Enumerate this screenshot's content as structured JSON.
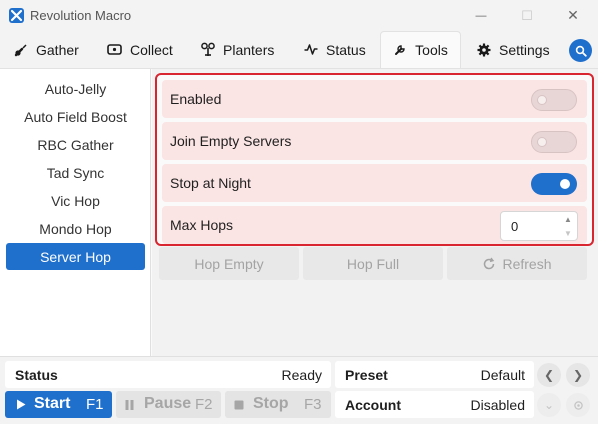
{
  "window": {
    "title": "Revolution Macro",
    "minimize_glyph": "—",
    "maximize_glyph": "☐",
    "close_glyph": "✕"
  },
  "tabs": [
    {
      "label": "Gather",
      "icon": "gather-icon"
    },
    {
      "label": "Collect",
      "icon": "collect-icon"
    },
    {
      "label": "Planters",
      "icon": "planters-icon"
    },
    {
      "label": "Status",
      "icon": "status-icon"
    },
    {
      "label": "Tools",
      "icon": "tools-icon",
      "active": true
    },
    {
      "label": "Settings",
      "icon": "gear-icon"
    }
  ],
  "sidebar": {
    "items": [
      {
        "label": "Auto-Jelly"
      },
      {
        "label": "Auto Field Boost"
      },
      {
        "label": "RBC Gather"
      },
      {
        "label": "Tad Sync"
      },
      {
        "label": "Vic Hop"
      },
      {
        "label": "Mondo Hop"
      },
      {
        "label": "Server Hop",
        "active": true
      }
    ]
  },
  "server_hop": {
    "enabled": {
      "label": "Enabled",
      "value": false
    },
    "join_empty": {
      "label": "Join Empty Servers",
      "value": false
    },
    "stop_at_night": {
      "label": "Stop at Night",
      "value": true
    },
    "max_hops": {
      "label": "Max Hops",
      "value": "0"
    },
    "buttons": {
      "hop_empty": "Hop Empty",
      "hop_full": "Hop Full",
      "refresh": "Refresh"
    }
  },
  "bottom": {
    "status_label": "Status",
    "status_value": "Ready",
    "preset_label": "Preset",
    "preset_value": "Default",
    "account_label": "Account",
    "account_value": "Disabled",
    "start": {
      "label": "Start",
      "key": "F1"
    },
    "pause": {
      "label": "Pause",
      "key": "F2"
    },
    "stop": {
      "label": "Stop",
      "key": "F3"
    }
  },
  "colors": {
    "accent": "#1f6fcc",
    "highlight_border": "#d9252f",
    "row_background": "#fbe4e4"
  }
}
